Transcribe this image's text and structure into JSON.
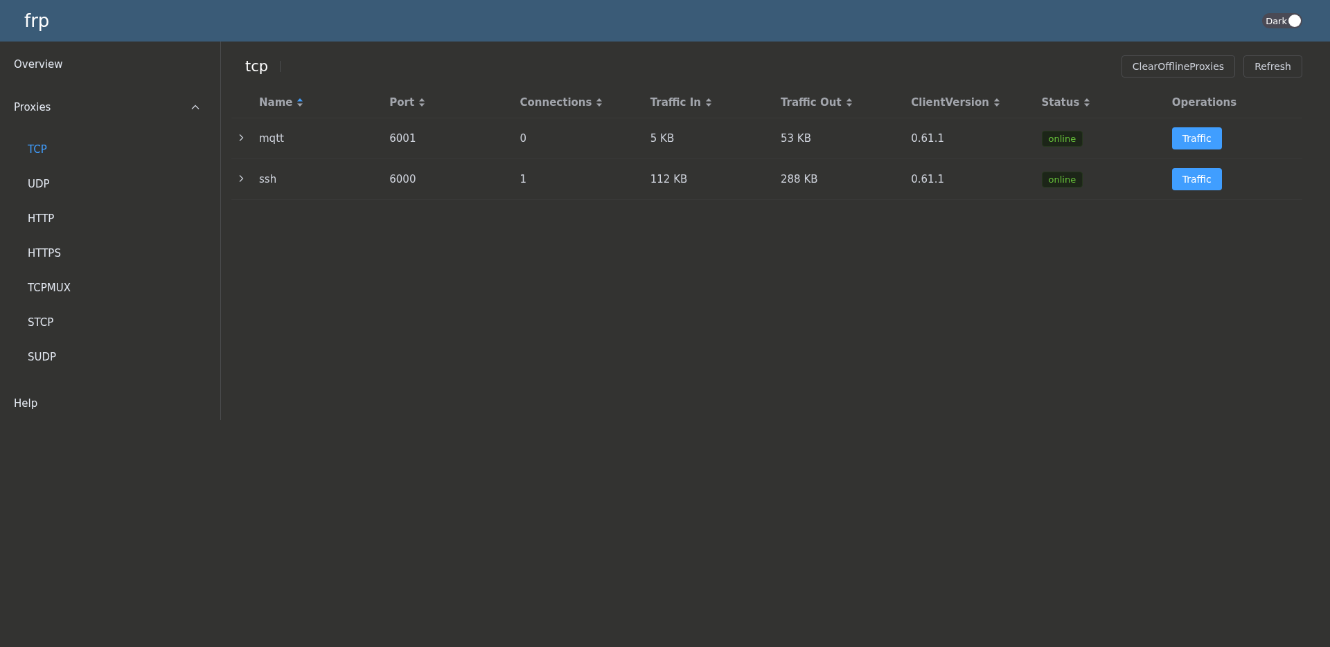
{
  "header": {
    "logo": "frp",
    "theme_switch": {
      "label": "Dark",
      "on": true
    }
  },
  "sidebar": {
    "items": [
      {
        "label": "Overview",
        "selected": false
      },
      {
        "label": "Proxies",
        "selected": false,
        "expanded": true,
        "children": [
          {
            "label": "TCP",
            "selected": true
          },
          {
            "label": "UDP",
            "selected": false
          },
          {
            "label": "HTTP",
            "selected": false
          },
          {
            "label": "HTTPS",
            "selected": false
          },
          {
            "label": "TCPMUX",
            "selected": false
          },
          {
            "label": "STCP",
            "selected": false
          },
          {
            "label": "SUDP",
            "selected": false
          }
        ]
      },
      {
        "label": "Help",
        "selected": false
      }
    ]
  },
  "content": {
    "title": "tcp",
    "buttons": [
      "ClearOfflineProxies",
      "Refresh"
    ],
    "table": {
      "columns": [
        {
          "label": "Name",
          "sortable": true,
          "sorted": true
        },
        {
          "label": "Port",
          "sortable": true,
          "sorted": false
        },
        {
          "label": "Connections",
          "sortable": true,
          "sorted": false
        },
        {
          "label": "Traffic In",
          "sortable": true,
          "sorted": false
        },
        {
          "label": "Traffic Out",
          "sortable": true,
          "sorted": false
        },
        {
          "label": "ClientVersion",
          "sortable": true,
          "sorted": false
        },
        {
          "label": "Status",
          "sortable": true,
          "sorted": false
        },
        {
          "label": "Operations",
          "sortable": false
        }
      ],
      "rows": [
        {
          "expanded": false,
          "cells": [
            "mqtt",
            "6001",
            "0",
            "5 KB",
            "53 KB",
            "0.61.1"
          ],
          "status": "online",
          "action": "Traffic"
        },
        {
          "expanded": false,
          "cells": [
            "ssh",
            "6000",
            "1",
            "112 KB",
            "288 KB",
            "0.61.1"
          ],
          "status": "online",
          "action": "Traffic"
        }
      ]
    }
  }
}
